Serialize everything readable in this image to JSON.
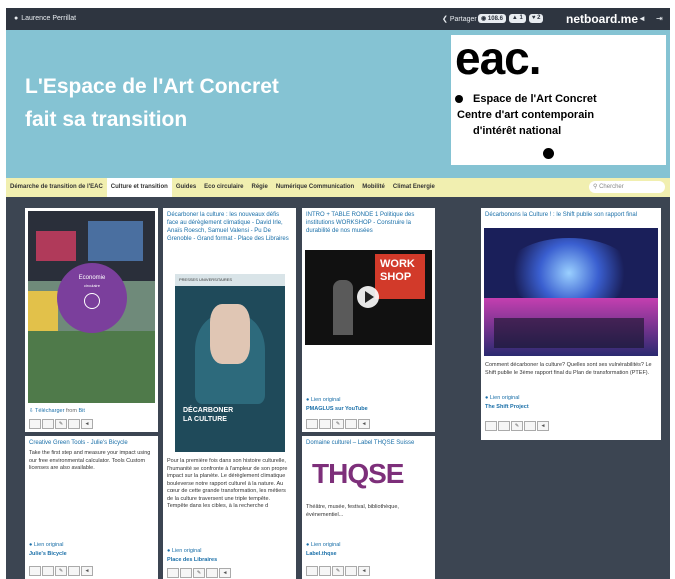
{
  "topbar": {
    "user": "Laurence Perrillat",
    "share": "Partager",
    "stats": [
      "108.6",
      "1",
      "2"
    ],
    "brand": "netboard.me"
  },
  "banner": {
    "title_line1": "L'Espace de l'Art Concret",
    "title_line2": "fait sa transition",
    "logo_mark": "eac.",
    "logo_line1": "Espace de l'Art Concret",
    "logo_line2": "Centre d'art contemporain",
    "logo_line3": "d'intérêt national"
  },
  "nav": {
    "items": [
      "Démarche de transition de l'EAC",
      "Culture et transition",
      "Guides",
      "Eco circulaire",
      "Régie",
      "Numérique Communication",
      "Mobilité",
      "Climat Energie"
    ],
    "active_index": 1,
    "search_placeholder": "Chercher"
  },
  "cards": {
    "c1": {
      "media_center": "Economie",
      "media_sub": "circulaire",
      "download": "Télécharger",
      "download_src": "from ",
      "download_host": "Bit"
    },
    "c2": {
      "title": "Décarboner la culture : les nouveaux défis face au dérèglement climatique - David Irle, Anaïs Roesch, Samuel Valensi - Pu De Grenoble - Grand format - Place des Libraires",
      "book_publisher": "PRESSES UNIVERSITAIRES",
      "book_title": "DÉCARBONER LA CULTURE",
      "desc": "Pour la première fois dans son histoire culturelle, l'humanité se confronte à l'ampleur de son propre impact sur la planète. Le dérèglement climatique bouleverse notre rapport culturel à la nature. Au cœur de cette grande transformation, les métiers de la culture traversent une triple tempête. Tempête dans les cibles, à la recherche d",
      "link": "Lien original",
      "source": "Place des Libraires"
    },
    "c3": {
      "title": "INTRO + TABLE RONDE 1 Politique des institutions WORKSHOP - Construire la durabilité de nos musées",
      "video_text1": "WORK",
      "video_text2": "SHOP",
      "link": "Lien original",
      "source": "PMAGLUS sur YouTube"
    },
    "c4": {
      "title": "Décarbonons la Culture ! : le Shift publie son rapport final",
      "desc": "Comment décarboner la culture? Quelles sont ses vulnérabilités? Le Shift publie le 3ème rapport final du Plan de transformation (PTEF).",
      "link": "Lien original",
      "source": "The Shift Project"
    },
    "c5": {
      "title": "Creative Green Tools - Julie's Bicycle",
      "desc": "Take the first step and measure your impact using our free environmental calculator. Tools Custom licenses are also available.",
      "link": "Lien original",
      "source": "Julie's Bicycle"
    },
    "c6": {
      "title": "Domaine culturel – Label THQSE Suisse",
      "logo": "THQSE",
      "desc": "Théâtre, musée, festival, bibliothèque, événementiel...",
      "link": "Lien original",
      "source": "Label.thqse"
    }
  },
  "colors": {
    "banner": "#85c3d3",
    "nav": "#f1efb0",
    "board": "#3c4552",
    "link": "#1a6fa8",
    "thqse": "#7d2f7a"
  },
  "icons": [
    "user-icon",
    "share-icon",
    "eye-icon",
    "comment-icon",
    "heart-icon",
    "sound-icon",
    "exit-icon",
    "search-icon",
    "play-icon",
    "link-icon",
    "download-icon"
  ]
}
